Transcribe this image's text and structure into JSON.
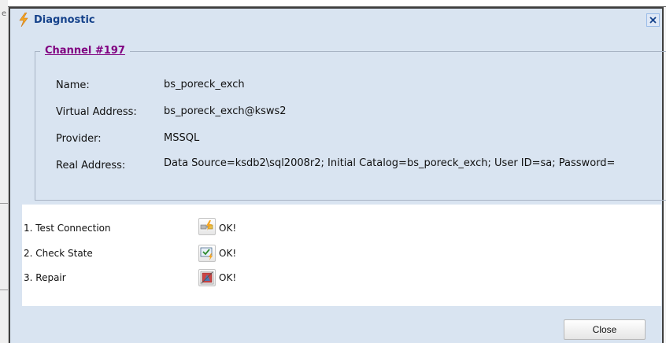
{
  "background": {
    "partial_text": "e"
  },
  "dialog": {
    "title": "Diagnostic",
    "title_icon": "lightning-icon",
    "close_icon": "close-icon"
  },
  "channel": {
    "legend": "Channel #197",
    "fields": [
      {
        "label": "Name:",
        "value": "bs_poreck_exch"
      },
      {
        "label": "Virtual Address:",
        "value": "bs_poreck_exch@ksws2"
      },
      {
        "label": "Provider:",
        "value": "MSSQL"
      },
      {
        "label": "Real Address:",
        "value": "Data Source=ksdb2\\sql2008r2; Initial Catalog=bs_poreck_exch; User ID=sa; Password="
      }
    ]
  },
  "actions": [
    {
      "label": "1. Test Connection",
      "icon": "plug-connection-icon",
      "result": "OK!"
    },
    {
      "label": "2. Check State",
      "icon": "check-state-icon",
      "result": "OK!"
    },
    {
      "label": "3. Repair",
      "icon": "repair-icon",
      "result": "OK!"
    }
  ],
  "footer": {
    "close_label": "Close"
  },
  "colors": {
    "title_text": "#15428b",
    "panel_bg": "#d9e4f1",
    "legend_link": "#800080",
    "border_blue": "#99bbe8"
  }
}
